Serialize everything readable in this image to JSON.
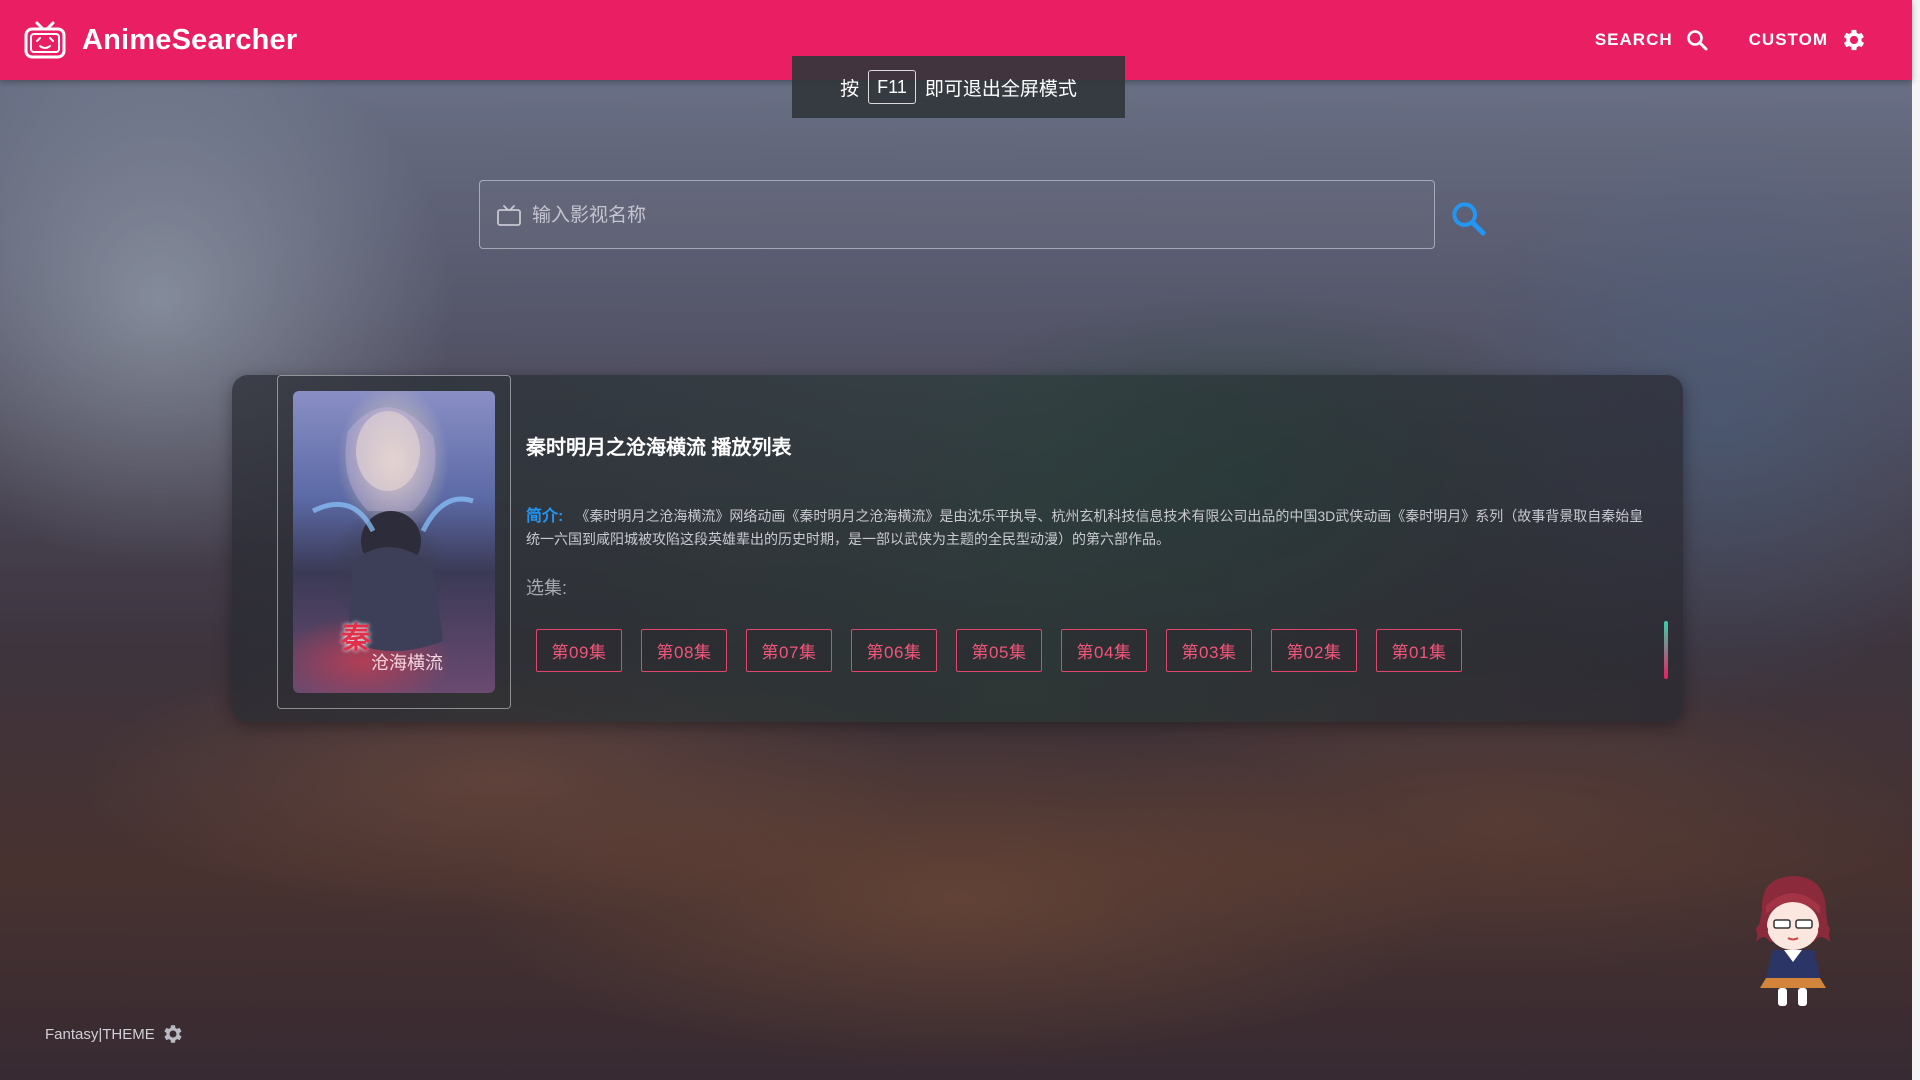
{
  "app": {
    "brand": "AnimeSearcher"
  },
  "nav": {
    "search_label": "SEARCH",
    "custom_label": "CUSTOM"
  },
  "toast": {
    "before": "按",
    "key": "F11",
    "after": "即可退出全屏模式"
  },
  "search": {
    "placeholder": "输入影视名称",
    "value": ""
  },
  "result": {
    "poster_title": "秦",
    "poster_subtitle": "沧海横流",
    "title": "秦时明月之沧海横流 播放列表",
    "intro_label": "简介:",
    "intro_text": "《秦时明月之沧海横流》网络动画《秦时明月之沧海横流》是由沈乐平执导、杭州玄机科技信息技术有限公司出品的中国3D武侠动画《秦时明月》系列（故事背景取自秦始皇统一六国到咸阳城被攻陷这段英雄辈出的历史时期，是一部以武侠为主题的全民型动漫）的第六部作品。",
    "episodes_label": "选集:",
    "episodes": [
      "第09集",
      "第08集",
      "第07集",
      "第06集",
      "第05集",
      "第04集",
      "第03集",
      "第02集",
      "第01集"
    ]
  },
  "footer": {
    "theme_label": "Fantasy|THEME"
  },
  "colors": {
    "appbar": "#e91e63",
    "accent_blue": "#2196f3",
    "episode_border": "#e0456b"
  }
}
